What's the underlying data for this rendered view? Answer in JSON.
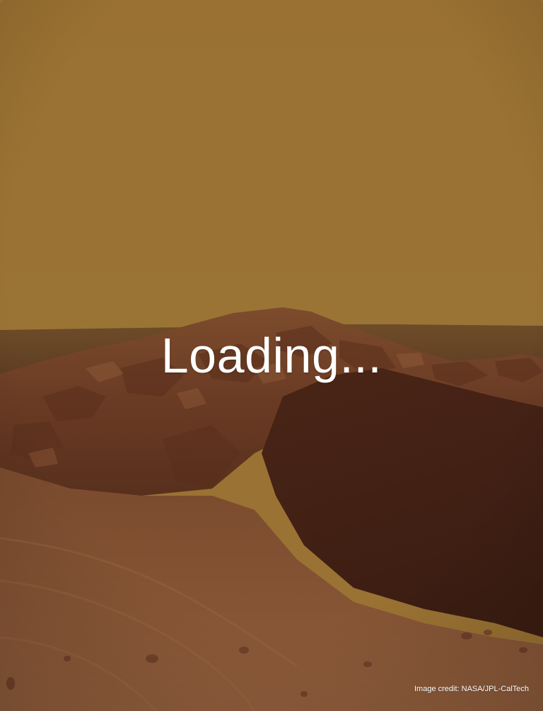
{
  "splash": {
    "loading_text": "Loading...",
    "credit_text": "Image credit: NASA/JPL-CalTech",
    "background_image": "mars-crater-landscape",
    "colors": {
      "sky": "#9a7233",
      "horizon": "#6b4a27",
      "ridge": "#7a4a2c",
      "shadow_slope": "#4d2718",
      "foreground": "#8a5a3a",
      "text": "#ffffff"
    }
  }
}
